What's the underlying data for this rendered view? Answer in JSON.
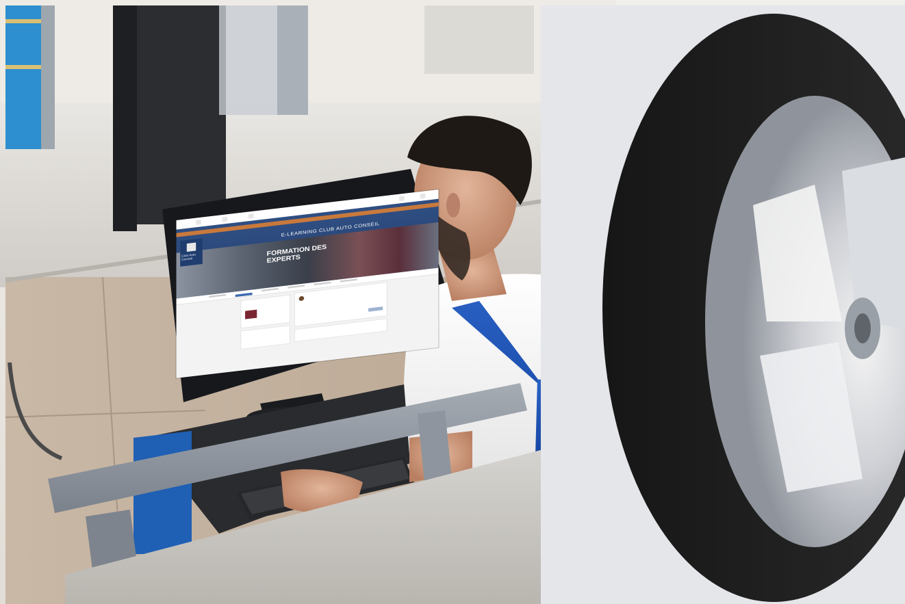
{
  "scene": {
    "description_free": true
  },
  "monitor_page": {
    "banner_title": "E-LEARNING CLUB AUTO CONSEIL",
    "banner_headline": "FORMATION DES EXPERTS",
    "logo_text": "Club Auto Conseil"
  },
  "colors": {
    "banner_blue": "#2f4f83",
    "accent_orange": "#c9793c",
    "overall_blue": "#1f56b4",
    "shirt_white": "#f4f4f4",
    "wall_tile": "#c7b7a4",
    "floor": "#d8d6d2"
  }
}
